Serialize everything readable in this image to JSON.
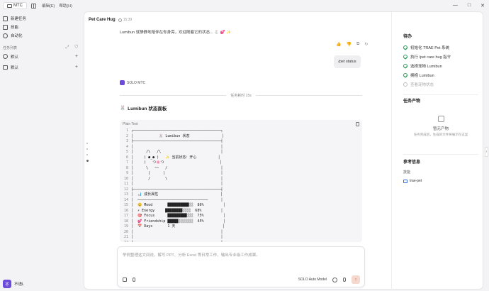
{
  "topbar": {
    "app_label": "MTC",
    "menus": [
      "编辑(E)",
      "帮助(H)"
    ],
    "window_controls": [
      "—",
      "□",
      "✕"
    ]
  },
  "sidebar": {
    "items": [
      {
        "label": "新建任务",
        "icon": "edit-icon"
      },
      {
        "label": "技能",
        "icon": "skill-icon"
      },
      {
        "label": "自动化",
        "icon": "automation-icon"
      }
    ],
    "task_list_label": "任务列表",
    "task_actions": [
      "⤢",
      "⛉"
    ],
    "groups": [
      {
        "label": "默认",
        "icon": "user-icon",
        "action": "+"
      },
      {
        "label": "默认",
        "icon": "folder-icon",
        "action": "+"
      }
    ],
    "user": {
      "avatar_letter": "不",
      "name": "不语L"
    }
  },
  "chat": {
    "title": "Pet Care Hug",
    "time": "15:39",
    "top_message": "Lumibun 就静静地陪伴在你身旁，欢迎随着它的状态... 🐇 💕 ✨",
    "actions": [
      "👍",
      "👎",
      "⧉",
      "↻"
    ],
    "user_message": "/pet status",
    "agent_name": "SOLO MTC",
    "divider_text": "任务耗时 15s",
    "panel_icon": "🐰",
    "panel_title": "Lumibun 状态面板",
    "code_lang": "Plain Text",
    "code_lines": [
      "┌─────────────────────────────────────────┐",
      "│            🐰 Lumibun 状态               │",
      "├─────────────────────────────────────────┤",
      "│                                         │",
      "│      /\\   /\\                            │",
      "│     ( ●_● )   ✨ 当前状态：开心          │",
      "│     (   つ🌸つ                          │",
      "│      \\   ~~   /                         │",
      "│       |      |                          │",
      "│       /       \\                         │",
      "│                                         │",
      "├─────────────────────────────────────────┤",
      "│  📊 成长属性                             │",
      "│  ─────────────────────────────────      │",
      "│  😊 Mood       ██████████░░  86%         │",
      "│  ⚡ Energy     ████████░░░░  68%         │",
      "│  🎯 Focus      █████████░░░  75%         │",
      "│  💕 Friendship █████░░░░░░░  45%         │",
      "│  📅 Days       1 天                      │",
      "│                                         │",
      "│                                         │",
      "└─────────────────────────────────────────┘"
    ],
    "input_placeholder": "举例整理这文间说，解写 PPT、分析 Excel 等日常工作，输出专业级工作成果。",
    "model_label": "SOLO Auto Model",
    "send_icon": "↑"
  },
  "right_panel": {
    "todo_title": "待办",
    "todos": [
      {
        "label": "初始化 TRAE Pet 系统",
        "done": true
      },
      {
        "label": "执行 /pet care hug 指令",
        "done": true
      },
      {
        "label": "选择宠物 Lumibun",
        "done": true
      },
      {
        "label": "拥抱 Lumibun",
        "done": true
      },
      {
        "label": "查看宠物状态",
        "done": false
      }
    ],
    "artifacts_title": "任务产物",
    "empty_title": "暂无产物",
    "empty_sub": "任务完成后，生成的文件将展示在这里",
    "ref_title": "参考信息",
    "skills_label": "技能",
    "skill_name": "trae-pet"
  }
}
